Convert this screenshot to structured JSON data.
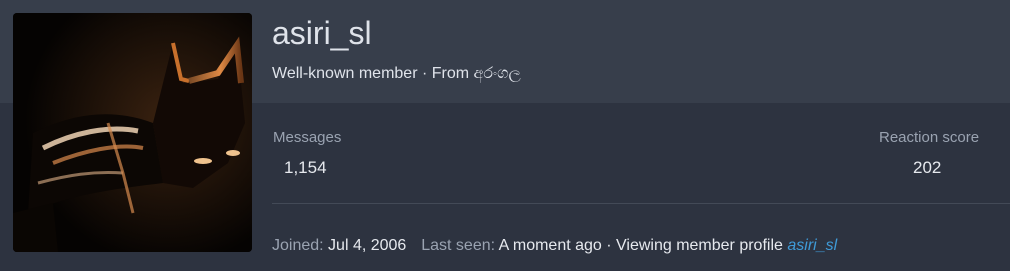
{
  "profile": {
    "username": "asiri_sl",
    "user_title": "Well-known member",
    "separator": " · ",
    "from_label": "From ",
    "location": "අරංගල"
  },
  "stats": {
    "messages_label": "Messages",
    "messages_value": "1,154",
    "reaction_label": "Reaction score",
    "reaction_value": "202"
  },
  "footer": {
    "joined_label": "Joined:",
    "joined_value": "Jul 4, 2006",
    "last_seen_label": "Last seen:",
    "last_seen_value": "A moment ago",
    "separator": " · ",
    "activity": "Viewing member profile ",
    "activity_link": "asiri_sl"
  },
  "colors": {
    "background": "#2d3340",
    "header_band": "#373e4b",
    "text": "#dfe3ea",
    "muted": "#9aa3b1",
    "link": "#3f9bd8"
  }
}
